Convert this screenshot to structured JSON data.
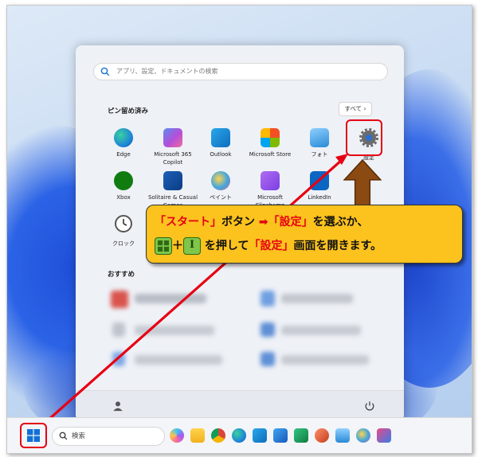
{
  "search": {
    "placeholder": "アプリ、設定、ドキュメントの検索"
  },
  "pinned": {
    "title": "ピン留め済み",
    "all_label": "すべて ›",
    "apps": [
      {
        "label": "Edge",
        "icon": "edge-icon",
        "color": "#1e88d6"
      },
      {
        "label": "Microsoft 365 Copilot",
        "icon": "m365-copilot-icon",
        "color": "#b44fd8"
      },
      {
        "label": "Outlook",
        "icon": "outlook-icon",
        "color": "#0f6cbd"
      },
      {
        "label": "Microsoft Store",
        "icon": "store-icon",
        "color": "#2b7de9"
      },
      {
        "label": "フォト",
        "icon": "photos-icon",
        "color": "#2a8ad6"
      },
      {
        "label": "設定",
        "icon": "gear-icon",
        "color": "#6b6b6b"
      },
      {
        "label": "Xbox",
        "icon": "xbox-icon",
        "color": "#107c10"
      },
      {
        "label": "Solitaire & Casual Games",
        "icon": "solitaire-icon",
        "color": "#1d5fb8"
      },
      {
        "label": "ペイント",
        "icon": "paint-icon",
        "color": "#3fa6e0"
      },
      {
        "label": "Microsoft Clipchamp",
        "icon": "clipchamp-icon",
        "color": "#7b3fe4"
      },
      {
        "label": "LinkedIn",
        "icon": "linkedin-icon",
        "color": "#0a66c2"
      },
      {
        "label": "クロック",
        "icon": "clock-icon",
        "color": "#555555"
      }
    ]
  },
  "recommended": {
    "title": "おすすめ"
  },
  "taskbar": {
    "search_label": "検索",
    "icons": [
      "copilot-icon",
      "file-explorer-icon",
      "chrome-icon",
      "edge-icon",
      "outlook-icon",
      "word-icon",
      "excel-icon",
      "powerpoint-icon",
      "notepad-icon",
      "paint-icon",
      "snipping-tool-icon"
    ]
  },
  "callout": {
    "start": "「スタート」",
    "button": "ボタン",
    "arrow": "➡",
    "settings1": "「設定」",
    "select": "を選ぶか、",
    "plus": "＋",
    "key_i": "I",
    "press": "を押して",
    "settings2": "「設定」",
    "open": "画面を開きます。"
  },
  "colors": {
    "accent_red": "#e60012",
    "callout_bg": "#fcc21e",
    "key_green": "#7fc64b"
  }
}
